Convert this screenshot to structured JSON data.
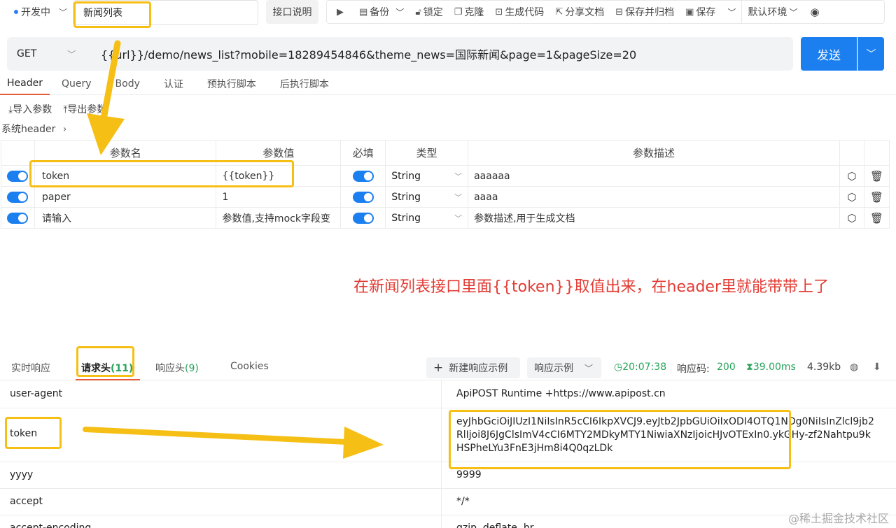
{
  "top": {
    "status": "开发中",
    "title": "新闻列表",
    "doc_button": "接口说明",
    "toolbar": [
      "备份",
      "锁定",
      "克隆",
      "生成代码",
      "分享文档",
      "保存并归档",
      "保存"
    ],
    "environment": "默认环境"
  },
  "request": {
    "method": "GET",
    "url": "{{url}}/demo/news_list?mobile=18289454846&theme_news=国际新闻&page=1&pageSize=20",
    "send": "发送"
  },
  "req_tabs": [
    "Header",
    "Query",
    "Body",
    "认证",
    "预执行脚本",
    "后执行脚本"
  ],
  "io": {
    "import": "导入参数",
    "export": "导出参数"
  },
  "sys_header": "系统header",
  "params": {
    "headers": [
      "参数名",
      "参数值",
      "必填",
      "类型",
      "参数描述"
    ],
    "rows": [
      {
        "name": "token",
        "value": "{{token}}",
        "type": "String",
        "desc": "aaaaaa"
      },
      {
        "name": "paper",
        "value": "1",
        "type": "String",
        "desc": "aaaa"
      },
      {
        "name": "请输入",
        "value": "参数值,支持mock字段变",
        "type": "String",
        "desc": "参数描述,用于生成文档"
      }
    ]
  },
  "annotation": "在新闻列表接口里面{{token}}取值出来，在header里就能带带上了",
  "response": {
    "tabs": {
      "realtime": "实时响应",
      "req_headers": "请求头",
      "req_count": "(11)",
      "resp_headers": "响应头",
      "resp_count": "(9)",
      "cookies": "Cookies"
    },
    "new_example": "新建响应示例",
    "example": "响应示例",
    "time": "20:07:38",
    "code_label": "响应码:",
    "code": "200",
    "duration": "39.00ms",
    "size": "4.39kb",
    "rows": [
      {
        "key": "user-agent",
        "value": "ApiPOST Runtime +https://www.apipost.cn"
      },
      {
        "key": "token",
        "value": "eyJhbGciOiJIUzI1NiIsInR5cCI6IkpXVCJ9.eyJtb2JpbGUiOiIxODI4OTQ1NDg0NiIsInZlcl9jb2RlIjoi8J6JgClsImV4cCI6MTY2MDkyMTY1NiwiaXNzIjoicHJvOTExIn0.ykGHy-zf2Nahtpu9kHSPheLYu3FnE3jHm8i4Q0qzLDk"
      },
      {
        "key": "yyyy",
        "value": "9999"
      },
      {
        "key": "accept",
        "value": "*/*"
      },
      {
        "key": "accept-encoding",
        "value": "gzip, deflate, br"
      }
    ]
  },
  "watermark": "@稀土掘金技术社区"
}
